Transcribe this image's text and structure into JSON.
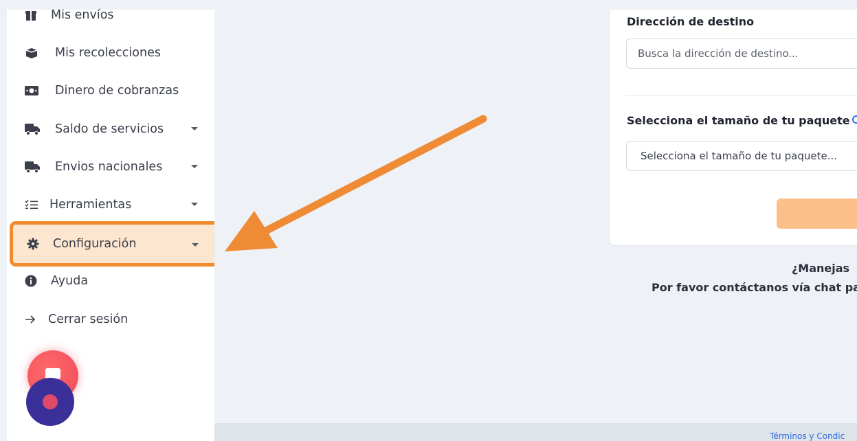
{
  "sidebar": {
    "items": [
      {
        "label": "Mis envíos",
        "icon": "gift-icon"
      },
      {
        "label": "Mis recolecciones",
        "icon": "box-icon"
      },
      {
        "label": "Dinero de cobranzas",
        "icon": "money-icon"
      },
      {
        "label": "Saldo de servicios",
        "icon": "truck-icon",
        "has_caret": true
      },
      {
        "label": "Envios nacionales",
        "icon": "truck-icon",
        "has_caret": true
      },
      {
        "label": "Herramientas",
        "icon": "checklist-icon",
        "has_caret": true
      },
      {
        "label": "Configuración",
        "icon": "gear-icon",
        "has_caret": true,
        "active": true
      },
      {
        "label": "Ayuda",
        "icon": "info-icon"
      },
      {
        "label": "Cerrar sesión",
        "icon": "arrow-right-icon"
      }
    ]
  },
  "form": {
    "destination_label": "Dirección de destino",
    "destination_placeholder": "Busca la dirección de destino...",
    "package_label": "Selecciona el tamaño de tu paquete",
    "package_select_value": "Selecciona el tamaño de tu paquete..."
  },
  "notes": {
    "line1": "¿Manejas",
    "line2": "Por favor contáctanos vía chat pa"
  },
  "footer": {
    "link": "Términos y Condic"
  },
  "colors": {
    "highlight_border": "#f08c2d",
    "highlight_fill": "#fde6cf",
    "arrow": "#ef8a35",
    "submit_button": "#fbbf8a"
  }
}
